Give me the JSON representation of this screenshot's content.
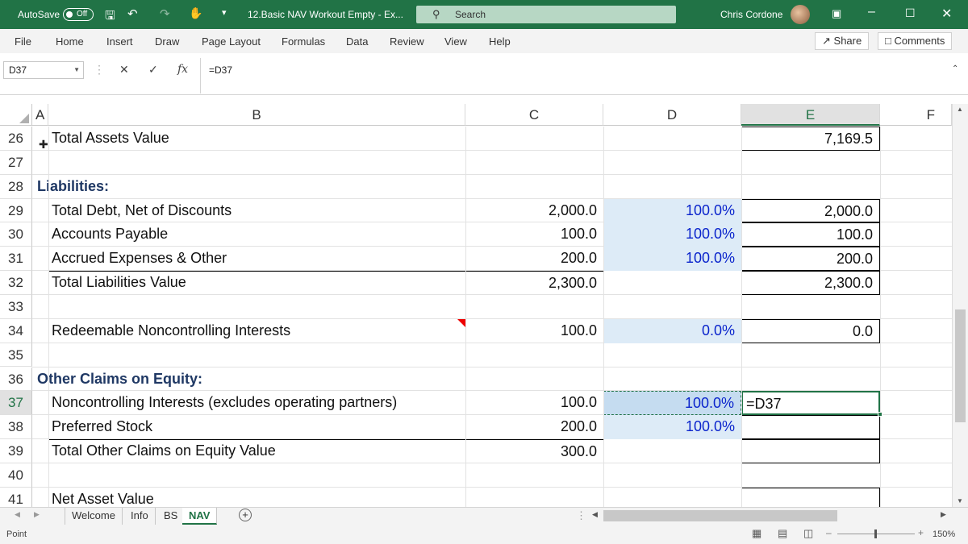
{
  "titlebar": {
    "autosave_label": "AutoSave",
    "autosave_state": "Off",
    "doc_title": "12.Basic NAV Workout Empty  -  Ex...",
    "search_placeholder": "Search",
    "user_name": "Chris Cordone"
  },
  "menu": {
    "tabs": [
      "File",
      "Home",
      "Insert",
      "Draw",
      "Page Layout",
      "Formulas",
      "Data",
      "Review",
      "View",
      "Help"
    ],
    "share": "Share",
    "comments": "Comments"
  },
  "formula_bar": {
    "name_box": "D37",
    "formula": "=D37"
  },
  "columns": [
    "A",
    "B",
    "C",
    "D",
    "E",
    "F"
  ],
  "rows": [
    {
      "n": "26",
      "b": "Total Assets Value",
      "c": "",
      "d": "",
      "e": "7,169.5"
    },
    {
      "n": "27",
      "b": "",
      "c": "",
      "d": "",
      "e": ""
    },
    {
      "n": "28",
      "a": "Liabilities:",
      "b": "",
      "c": "",
      "d": "",
      "e": ""
    },
    {
      "n": "29",
      "b": "Total Debt, Net of Discounts",
      "c": "2,000.0",
      "d": "100.0%",
      "e": "2,000.0"
    },
    {
      "n": "30",
      "b": "Accounts Payable",
      "c": "100.0",
      "d": "100.0%",
      "e": "100.0"
    },
    {
      "n": "31",
      "b": "Accrued Expenses & Other",
      "c": "200.0",
      "d": "100.0%",
      "e": "200.0"
    },
    {
      "n": "32",
      "b": "Total Liabilities Value",
      "c": "2,300.0",
      "d": "",
      "e": "2,300.0"
    },
    {
      "n": "33",
      "b": "",
      "c": "",
      "d": "",
      "e": ""
    },
    {
      "n": "34",
      "b": "Redeemable Noncontrolling Interests",
      "c": "100.0",
      "d": "0.0%",
      "e": "0.0"
    },
    {
      "n": "35",
      "b": "",
      "c": "",
      "d": "",
      "e": ""
    },
    {
      "n": "36",
      "a": "Other Claims on Equity:",
      "b": "",
      "c": "",
      "d": "",
      "e": ""
    },
    {
      "n": "37",
      "b": "Noncontrolling Interests (excludes operating partners)",
      "c": "100.0",
      "d": "100.0%",
      "e": "=D37"
    },
    {
      "n": "38",
      "b": "Preferred Stock",
      "c": "200.0",
      "d": "100.0%",
      "e": ""
    },
    {
      "n": "39",
      "b": "Total Other Claims on Equity Value",
      "c": "300.0",
      "d": "",
      "e": ""
    },
    {
      "n": "40",
      "b": "",
      "c": "",
      "d": "",
      "e": ""
    },
    {
      "n": "41",
      "b": "Net Asset Value",
      "c": "",
      "d": "",
      "e": ""
    }
  ],
  "sheets": [
    "Welcome",
    "Info",
    "BS",
    "NAV"
  ],
  "active_sheet": "NAV",
  "status": {
    "mode": "Point",
    "zoom": "150%"
  },
  "colors": {
    "accent": "#217346",
    "input_blue": "#0a24cc",
    "header_navy": "#1f3864",
    "input_shade": "#ddebf7"
  }
}
